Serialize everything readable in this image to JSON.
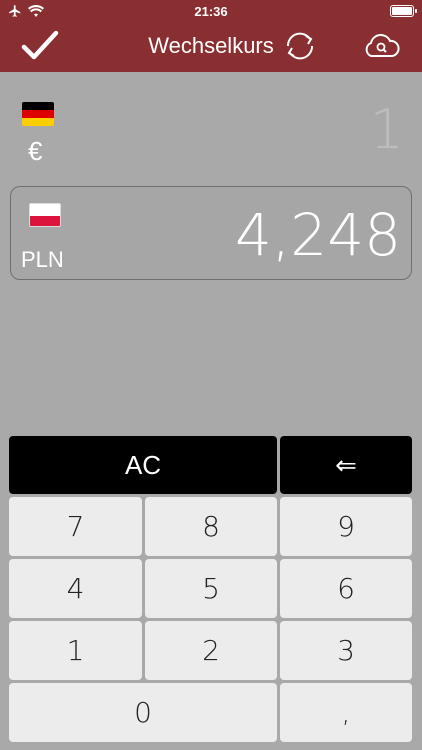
{
  "status_bar": {
    "time": "21:36"
  },
  "nav": {
    "title": "Wechselkurs"
  },
  "source": {
    "symbol": "€",
    "value": "1",
    "flag_colors": [
      "#000000",
      "#dd0000",
      "#ffce00"
    ]
  },
  "result": {
    "code": "PLN",
    "value": "4,248",
    "flag_colors": [
      "#ffffff",
      "#dc143c"
    ]
  },
  "keypad": {
    "clear": "AC",
    "backspace": "⇐",
    "digits": {
      "d7": "7",
      "d8": "8",
      "d9": "9",
      "d4": "4",
      "d5": "5",
      "d6": "6",
      "d1": "1",
      "d2": "2",
      "d3": "3",
      "d0": "0"
    },
    "decimal": ","
  },
  "colors": {
    "header": "#8a2f31",
    "background": "#a9a9a9",
    "key": "#ececec",
    "key_dark": "#000000"
  }
}
